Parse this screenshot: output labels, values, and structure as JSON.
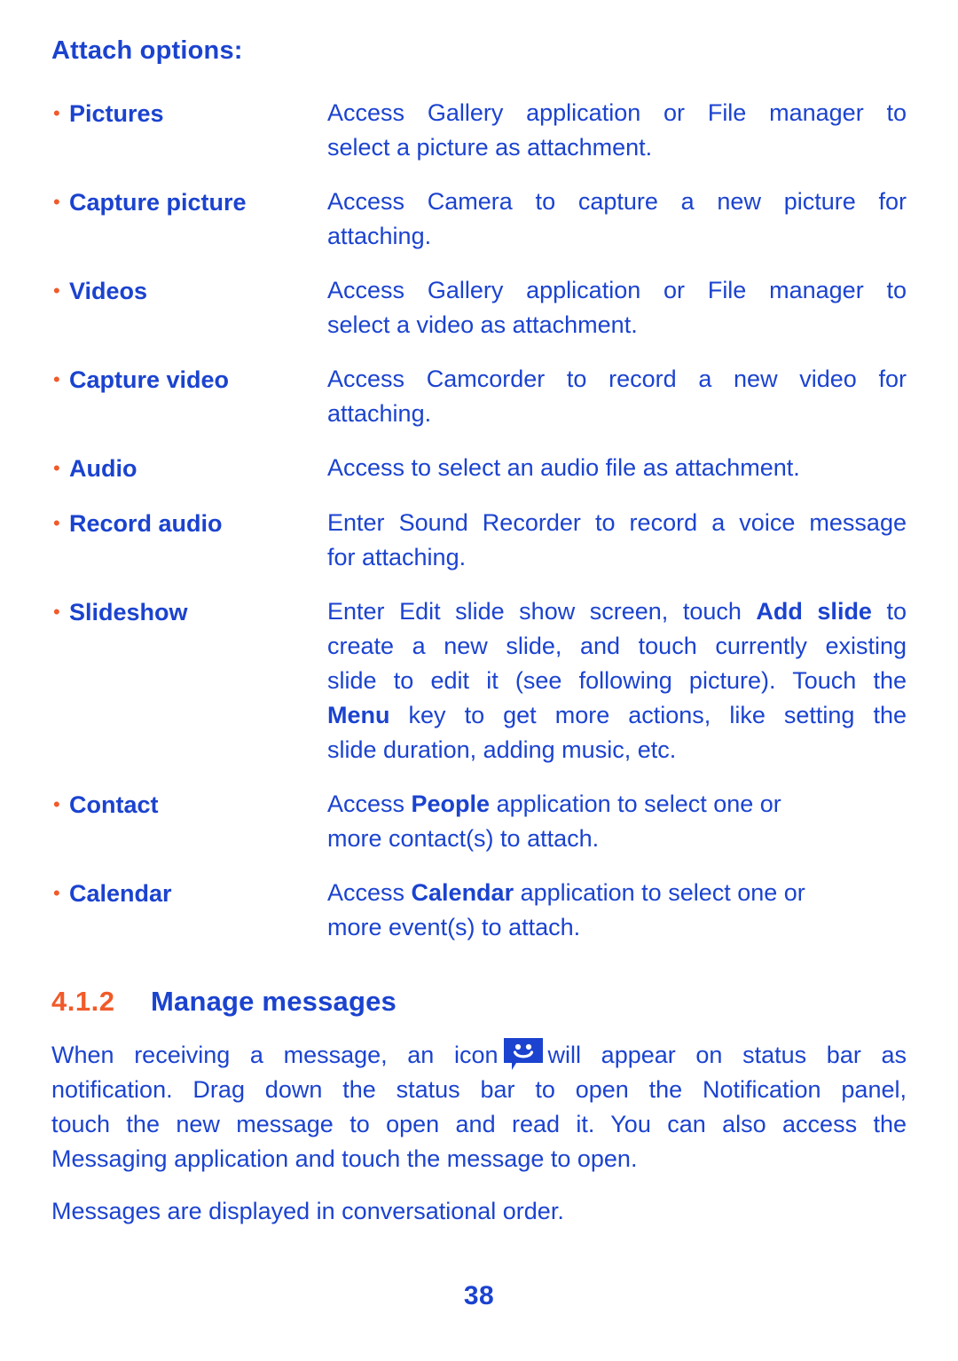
{
  "page": {
    "number": "38",
    "background_color": "#ffffff",
    "text_color": "#1b43cf",
    "accent_color": "#f15a29"
  },
  "attach": {
    "heading": "Attach options:",
    "bullet_glyph": "•",
    "options": [
      {
        "term": "Pictures",
        "lines": [
          "Access Gallery application or File manager to",
          "select a picture as attachment."
        ]
      },
      {
        "term": "Capture picture",
        "lines": [
          "Access Camera to capture a new picture for",
          "attaching."
        ]
      },
      {
        "term": "Videos",
        "lines": [
          "Access Gallery application or File manager to",
          "select a video as attachment."
        ]
      },
      {
        "term": "Capture video",
        "lines": [
          "Access Camcorder to record a new video for",
          "attaching."
        ]
      },
      {
        "term": "Audio",
        "lines": [
          "Access to select an audio file as attachment."
        ]
      },
      {
        "term": "Record audio",
        "lines": [
          "Enter Sound Recorder to record a voice message",
          "for attaching."
        ]
      },
      {
        "term": "Slideshow",
        "lines": [
          "Enter Edit slide show screen, touch Add slide to",
          "create a new slide, and touch currently existing",
          "slide to edit it (see following picture). Touch the",
          "Menu key to get more actions, like setting the",
          "slide duration, adding music, etc."
        ],
        "bold_terms": [
          "Add slide",
          "Menu"
        ]
      },
      {
        "term": "Contact",
        "lines": [
          "Access People application to select one or",
          "more contact(s) to attach."
        ],
        "bold_terms": [
          "People"
        ]
      },
      {
        "term": "Calendar",
        "lines": [
          "Access Calendar application to select one or",
          "more event(s) to attach."
        ],
        "bold_terms": [
          "Calendar"
        ]
      }
    ]
  },
  "section": {
    "number": "4.1.2",
    "title": "Manage messages"
  },
  "body": {
    "paragraph1_lines": [
      "When receiving a message, an icon",
      "will appear on status bar as",
      "notification. Drag down the status bar to open the Notification panel,",
      "touch the new message to open and read it. You can also access the",
      "Messaging application and touch the message to open."
    ],
    "paragraph1_part_a": "When receiving a message, an icon",
    "paragraph1_part_b": "will appear on status bar as",
    "paragraph1_line2": "notification. Drag down the status bar to open the Notification panel,",
    "paragraph1_line3": "touch the new message to open and read it. You can also access the",
    "paragraph1_line4": "Messaging application and touch the message to open.",
    "paragraph2": "Messages are displayed in conversational order.",
    "icon_name": "message-smiley-icon",
    "icon_color": "#1b43cf"
  }
}
